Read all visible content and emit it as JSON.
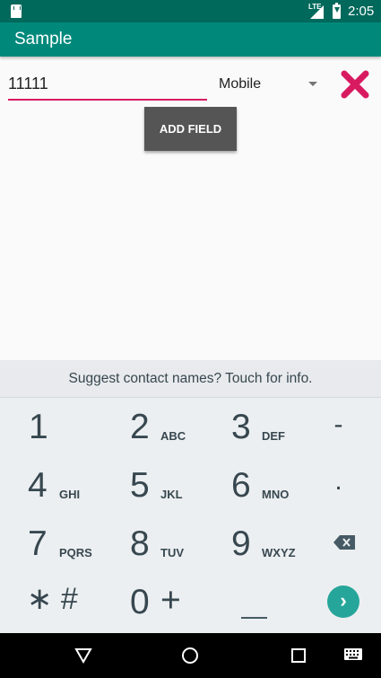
{
  "status_bar": {
    "network_label": "LTE",
    "time": "2:05",
    "icons": [
      "sd-card-icon",
      "signal-icon",
      "battery-charging-icon"
    ]
  },
  "app_bar": {
    "title": "Sample"
  },
  "form": {
    "phone_value": "11111",
    "phone_type": "Mobile",
    "add_field_label": "ADD FIELD",
    "delete_icon": "close-icon",
    "accent_color": "#d81b60"
  },
  "keyboard": {
    "suggestion_text": "Suggest contact names? Touch for info.",
    "keys": [
      {
        "digit": "1",
        "letters": ""
      },
      {
        "digit": "2",
        "letters": "ABC"
      },
      {
        "digit": "3",
        "letters": "DEF"
      },
      {
        "digit": "4",
        "letters": "GHI"
      },
      {
        "digit": "5",
        "letters": "JKL"
      },
      {
        "digit": "6",
        "letters": "MNO"
      },
      {
        "digit": "7",
        "letters": "PQRS"
      },
      {
        "digit": "8",
        "letters": "TUV"
      },
      {
        "digit": "9",
        "letters": "WXYZ"
      },
      {
        "digit": "0",
        "letters": ""
      }
    ],
    "symbols": {
      "minus": "-",
      "period": ".",
      "star_hash": "∗ #",
      "plus": "+"
    },
    "enter_icon": "chevron-right-icon",
    "backspace_icon": "backspace-icon"
  },
  "colors": {
    "status_bar": "#00695c",
    "app_bar": "#00897b",
    "keyboard_bg": "#eceff1",
    "go_button": "#26a69a"
  },
  "nav_bar": {
    "icons": [
      "back-icon",
      "home-icon",
      "recents-icon",
      "keyboard-icon"
    ]
  }
}
